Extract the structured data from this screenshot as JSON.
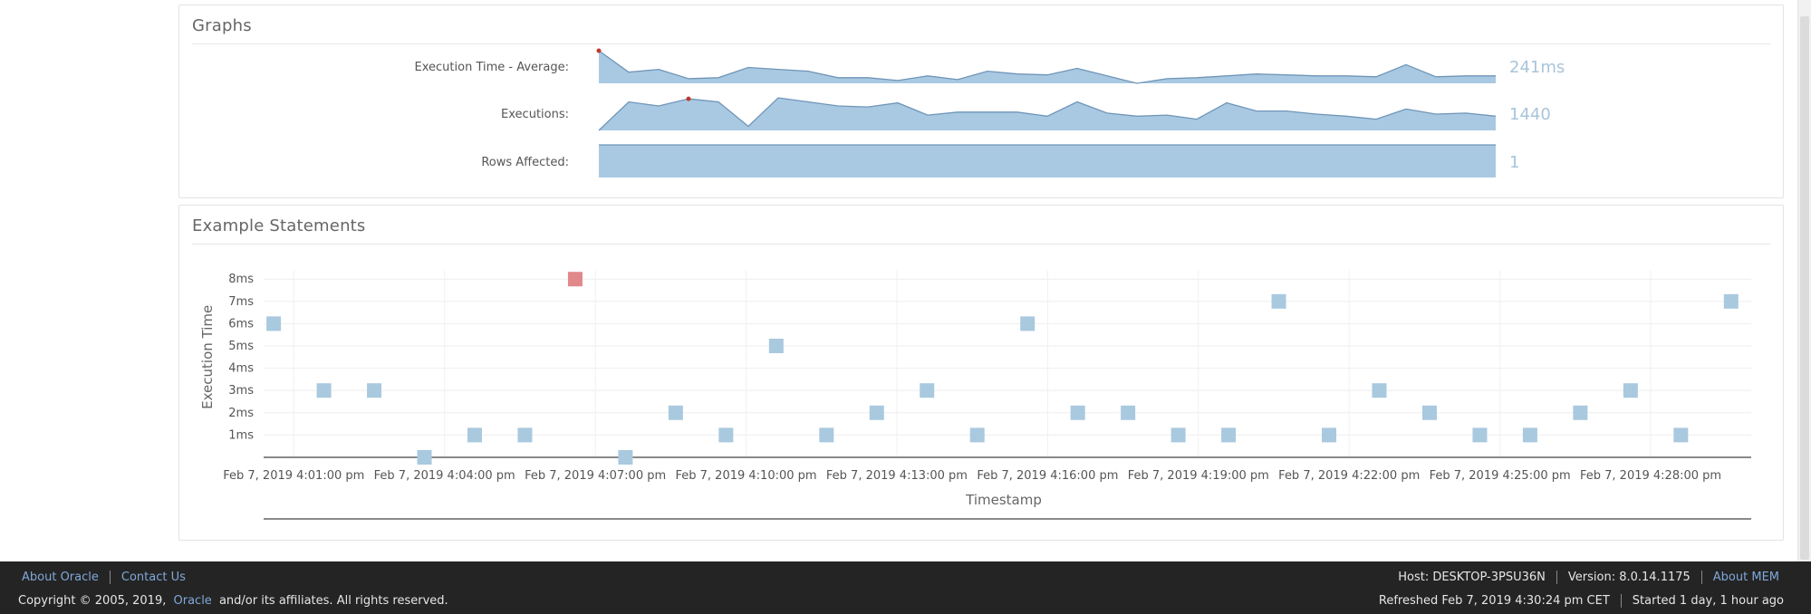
{
  "graphs": {
    "title": "Graphs",
    "sparklines": [
      {
        "label": "Execution Time - Average:",
        "value": "241ms",
        "values": [
          35,
          12,
          15,
          5,
          6,
          17,
          15,
          13,
          6,
          6,
          3,
          8,
          4,
          13,
          10,
          9,
          16,
          8,
          0,
          5,
          6,
          8,
          10,
          9,
          8,
          8,
          7,
          20,
          7,
          8,
          8
        ],
        "max_marker_index": 0
      },
      {
        "label": "Executions:",
        "value": "1440",
        "values": [
          0,
          28,
          24,
          31,
          28,
          4,
          32,
          28,
          24,
          23,
          27,
          15,
          18,
          18,
          18,
          14,
          28,
          17,
          14,
          15,
          11,
          27,
          19,
          19,
          16,
          14,
          11,
          21,
          16,
          17,
          14
        ],
        "max_marker_index": 3
      },
      {
        "label": "Rows Affected:",
        "value": "1",
        "values": [
          1,
          1,
          1,
          1,
          1,
          1,
          1,
          1,
          1,
          1,
          1,
          1,
          1,
          1,
          1,
          1,
          1,
          1,
          1,
          1,
          1,
          1,
          1,
          1,
          1,
          1,
          1,
          1,
          1,
          1,
          1
        ],
        "max_marker_index": null
      }
    ]
  },
  "examples": {
    "title": "Example Statements"
  },
  "chart_data": {
    "type": "scatter",
    "title": "Example Statements",
    "xlabel": "Timestamp",
    "ylabel": "Execution Time",
    "x_start": "Feb 7, 2019 4:00:35 pm",
    "x_interval_minutes": 1,
    "xlim_minutes_after_4pm": [
      0.4,
      30.0
    ],
    "ylim": [
      0,
      8.4
    ],
    "y_ticks": [
      "1ms",
      "2ms",
      "3ms",
      "4ms",
      "5ms",
      "6ms",
      "7ms",
      "8ms"
    ],
    "x_ticks": [
      {
        "minute": 1,
        "label": "Feb 7, 2019 4:01:00 pm"
      },
      {
        "minute": 4,
        "label": "Feb 7, 2019 4:04:00 pm"
      },
      {
        "minute": 7,
        "label": "Feb 7, 2019 4:07:00 pm"
      },
      {
        "minute": 10,
        "label": "Feb 7, 2019 4:10:00 pm"
      },
      {
        "minute": 13,
        "label": "Feb 7, 2019 4:13:00 pm"
      },
      {
        "minute": 16,
        "label": "Feb 7, 2019 4:16:00 pm"
      },
      {
        "minute": 19,
        "label": "Feb 7, 2019 4:19:00 pm"
      },
      {
        "minute": 22,
        "label": "Feb 7, 2019 4:22:00 pm"
      },
      {
        "minute": 25,
        "label": "Feb 7, 2019 4:25:00 pm"
      },
      {
        "minute": 28,
        "label": "Feb 7, 2019 4:28:00 pm"
      }
    ],
    "grid": true,
    "point_color": "#a9c9df",
    "highlight_color": "#e0888a",
    "points": [
      {
        "minute": 0.6,
        "ms": 6
      },
      {
        "minute": 1.6,
        "ms": 3
      },
      {
        "minute": 2.6,
        "ms": 3
      },
      {
        "minute": 3.6,
        "ms": 0
      },
      {
        "minute": 4.6,
        "ms": 1
      },
      {
        "minute": 5.6,
        "ms": 1
      },
      {
        "minute": 6.6,
        "ms": 8,
        "highlight": true
      },
      {
        "minute": 7.6,
        "ms": 0
      },
      {
        "minute": 8.6,
        "ms": 2
      },
      {
        "minute": 9.6,
        "ms": 1
      },
      {
        "minute": 10.6,
        "ms": 5
      },
      {
        "minute": 11.6,
        "ms": 1
      },
      {
        "minute": 12.6,
        "ms": 2
      },
      {
        "minute": 13.6,
        "ms": 3
      },
      {
        "minute": 14.6,
        "ms": 1
      },
      {
        "minute": 15.6,
        "ms": 6
      },
      {
        "minute": 16.6,
        "ms": 2
      },
      {
        "minute": 17.6,
        "ms": 2
      },
      {
        "minute": 18.6,
        "ms": 1
      },
      {
        "minute": 19.6,
        "ms": 1
      },
      {
        "minute": 20.6,
        "ms": 7
      },
      {
        "minute": 21.6,
        "ms": 1
      },
      {
        "minute": 22.6,
        "ms": 3
      },
      {
        "minute": 23.6,
        "ms": 2
      },
      {
        "minute": 24.6,
        "ms": 1
      },
      {
        "minute": 25.6,
        "ms": 1
      },
      {
        "minute": 26.6,
        "ms": 2
      },
      {
        "minute": 27.6,
        "ms": 3
      },
      {
        "minute": 28.6,
        "ms": 1
      },
      {
        "minute": 29.6,
        "ms": 7
      }
    ]
  },
  "footer": {
    "about_oracle": "About Oracle",
    "contact_us": "Contact Us",
    "copyright_prefix": "Copyright © 2005, 2019,",
    "oracle_link": "Oracle",
    "copyright_suffix": "and/or its affiliates. All rights reserved.",
    "host": "Host: DESKTOP-3PSU36N",
    "version": "Version: 8.0.14.1175",
    "about_mem": "About MEM",
    "refreshed": "Refreshed Feb 7, 2019 4:30:24 pm CET",
    "started": "Started 1 day, 1 hour ago"
  }
}
